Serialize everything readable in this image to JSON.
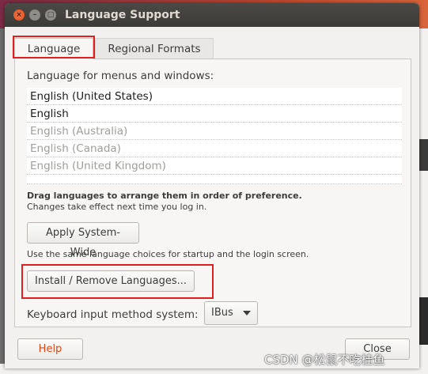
{
  "window": {
    "title": "Language Support",
    "close_glyph": "×",
    "min_glyph": "–",
    "max_glyph": "□"
  },
  "tabs": [
    {
      "label": "Language",
      "selected": true
    },
    {
      "label": "Regional Formats",
      "selected": false
    }
  ],
  "language_section": {
    "label": "Language for menus and windows:",
    "languages": [
      {
        "name": "English (United States)",
        "active": true
      },
      {
        "name": "English",
        "active": true
      },
      {
        "name": "English (Australia)",
        "active": false
      },
      {
        "name": "English (Canada)",
        "active": false
      },
      {
        "name": "English (United Kingdom)",
        "active": false
      }
    ],
    "drag_hint": "Drag languages to arrange them in order of preference.",
    "change_hint": "Changes take effect next time you log in.",
    "apply_button": "Apply System-Wide",
    "use_same_hint": "Use the same language choices for startup and the login screen.",
    "install_button": "Install / Remove Languages...",
    "keyboard_label": "Keyboard input method system:",
    "keyboard_value": "IBus"
  },
  "footer": {
    "help_button": "Help",
    "close_button": "Close"
  },
  "watermark": "CSDN @松鼠不吃桂鱼",
  "colors": {
    "highlight_box": "#e02020",
    "help_text": "#dd4814",
    "titlebar": "#3c3b37",
    "close_button": "#df4a16"
  }
}
